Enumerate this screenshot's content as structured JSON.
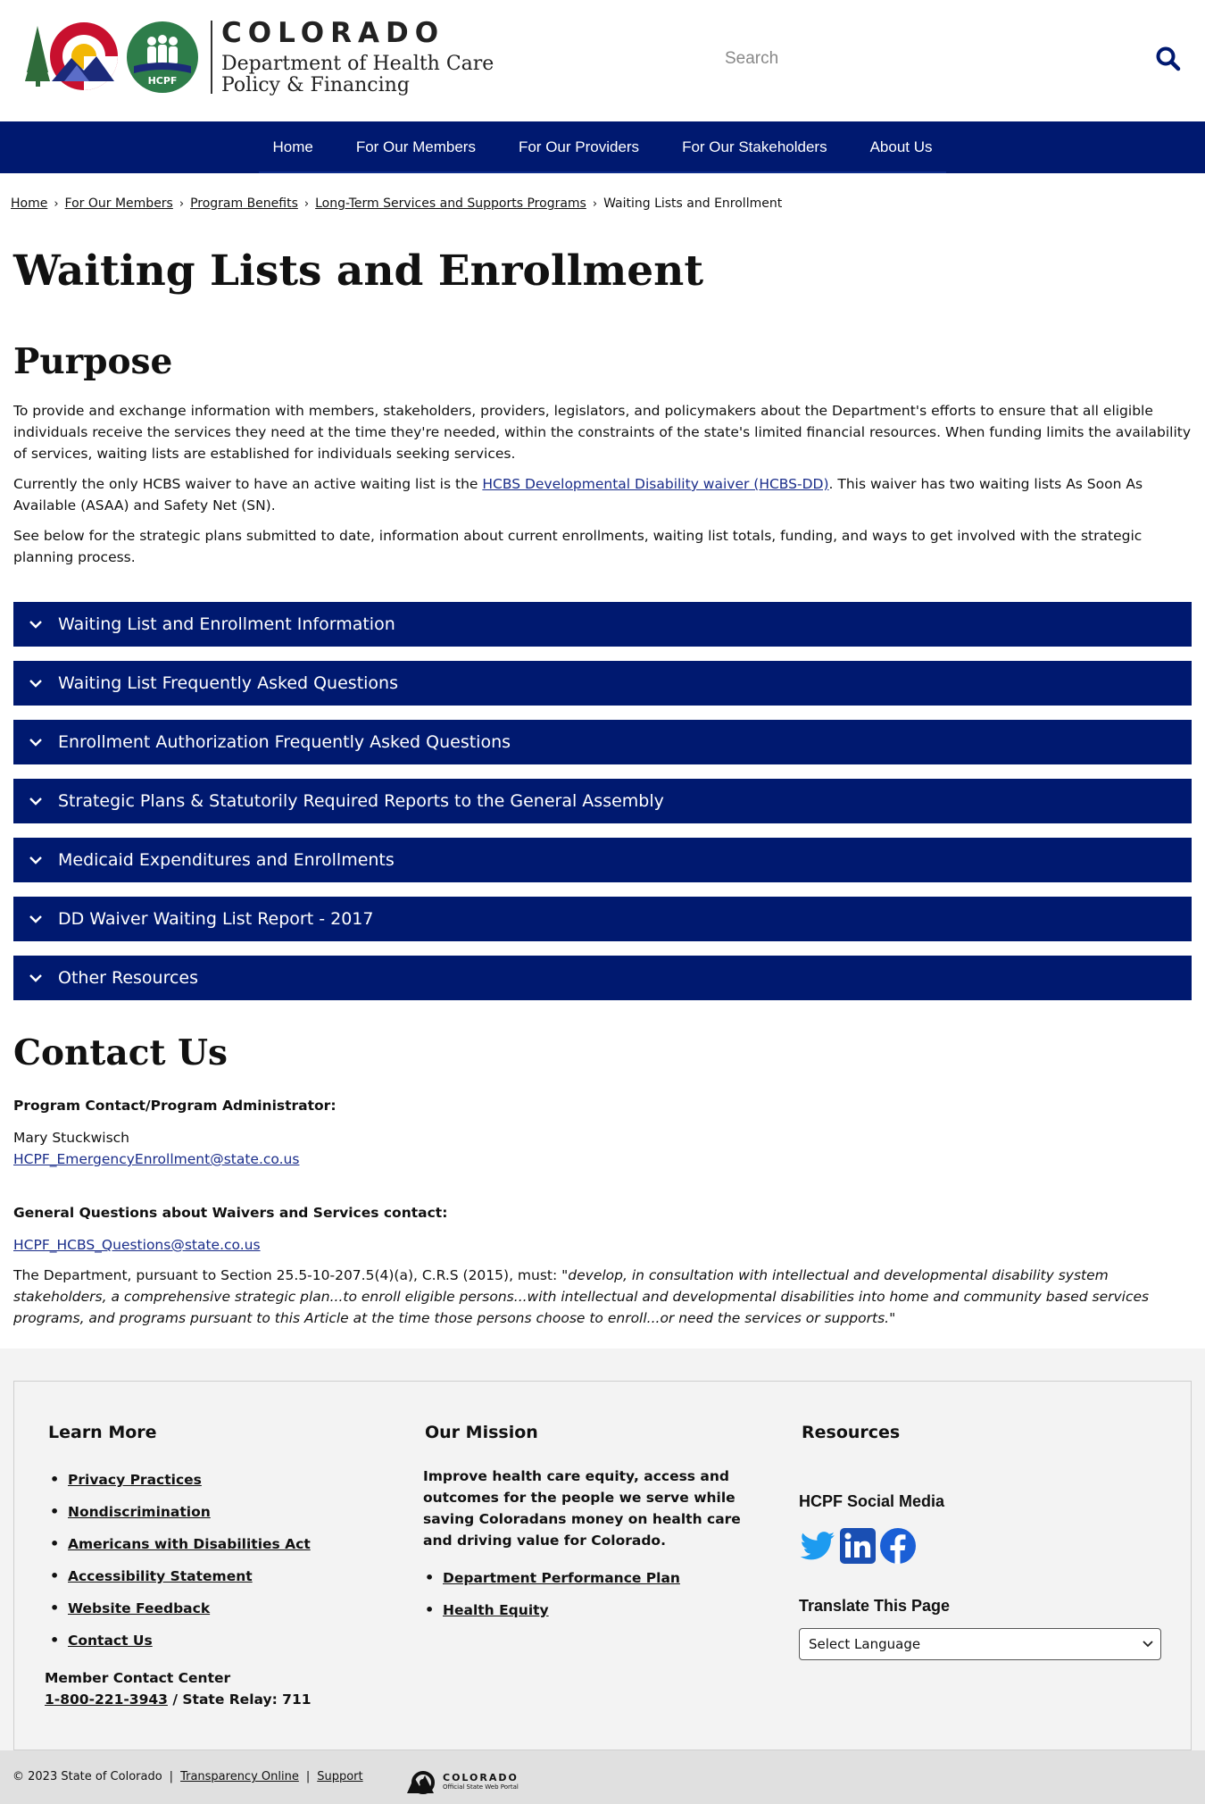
{
  "header": {
    "logo_colorado": "COLORADO",
    "logo_dept_line1": "Department of Health Care",
    "logo_dept_line2": "Policy & Financing",
    "hcpf_badge": "HCPF",
    "search_placeholder": "Search",
    "icons": {
      "search": "search-icon"
    }
  },
  "nav": {
    "items": [
      "Home",
      "For Our Members",
      "For Our Providers",
      "For Our Stakeholders",
      "About Us"
    ]
  },
  "breadcrumb": {
    "items": [
      "Home",
      "For Our Members",
      "Program Benefits",
      "Long-Term Services and Supports Programs"
    ],
    "current": "Waiting Lists and Enrollment",
    "separator": "›"
  },
  "main": {
    "title": "Waiting Lists and Enrollment",
    "purpose_heading": "Purpose",
    "purpose_p1": "To provide and exchange information with members, stakeholders, providers, legislators, and policymakers about the Department's efforts to ensure that all eligible individuals receive the services they need at the time they're needed, within the constraints of the state's limited financial resources. When funding limits the availability of services, waiting lists are established for individuals seeking services.",
    "purpose_p2_before": "Currently the only HCBS waiver to have an active waiting list is the ",
    "purpose_p2_link": "HCBS Developmental Disability waiver (HCBS-DD)",
    "purpose_p2_after": ".  This waiver has two waiting lists As Soon As Available (ASAA) and Safety Net (SN).",
    "purpose_p3": "See below for the strategic plans submitted to date, information about current enrollments, waiting list totals, funding, and ways to get involved with the strategic planning process.",
    "accordions": [
      "Waiting List and Enrollment Information",
      "Waiting List Frequently Asked Questions",
      "Enrollment Authorization Frequently Asked Questions",
      "Strategic Plans & Statutorily Required Reports to the General Assembly",
      "Medicaid Expenditures and Enrollments",
      "DD Waiver Waiting List Report - 2017",
      "Other Resources"
    ],
    "contact_heading": "Contact Us",
    "contact_label": "Program Contact/Program Administrator:",
    "contact_name": "Mary Stuckwisch",
    "contact_email": "HCPF_EmergencyEnrollment@state.co.us",
    "general_label": "General Questions about Waivers and Services contact:",
    "general_email": "HCPF_HCBS_Questions@state.co.us",
    "statute_before": "The Department, pursuant to Section 25.5-10-207.5(4)(a), C.R.S (2015), must: ",
    "statute_quote": "\"develop, in consultation with intellectual and developmental disability system stakeholders, a comprehensive strategic plan...to enroll eligible persons...with intellectual and developmental disabilities into home and community based services programs, and programs pursuant to this Article at the time those persons choose to enroll...or need the services or supports.\""
  },
  "footer": {
    "learn_more": {
      "heading": "Learn More",
      "links": [
        "Privacy Practices",
        "Nondiscrimination",
        "Americans with Disabilities Act",
        "Accessibility Statement",
        "Website Feedback",
        "Contact Us"
      ]
    },
    "member_contact": {
      "label": "Member Contact Center",
      "phone": "1-800-221-3943",
      "relay": " / State Relay: 711"
    },
    "mission": {
      "heading": "Our Mission",
      "text": "Improve health care equity, access and outcomes for the people we serve while saving Coloradans money on health care and driving value for Colorado.",
      "links": [
        "Department Performance Plan",
        "Health Equity"
      ]
    },
    "resources": {
      "heading": "Resources",
      "social_heading": "HCPF Social Media",
      "social_icons": [
        "twitter-icon",
        "linkedin-icon",
        "facebook-icon"
      ],
      "translate_heading": "Translate This Page",
      "select_value": "Select Language"
    }
  },
  "bottom": {
    "copyright": "© 2023 State of Colorado",
    "links": [
      "Transparency Online",
      "Support"
    ],
    "portal_line1": "COLORADO",
    "portal_line2": "Official State Web Portal"
  },
  "colors": {
    "navy": "#001970",
    "link": "#1a2d8a",
    "footer_bg": "#f3f3f3",
    "bottom_bar": "#e0e0e0"
  }
}
